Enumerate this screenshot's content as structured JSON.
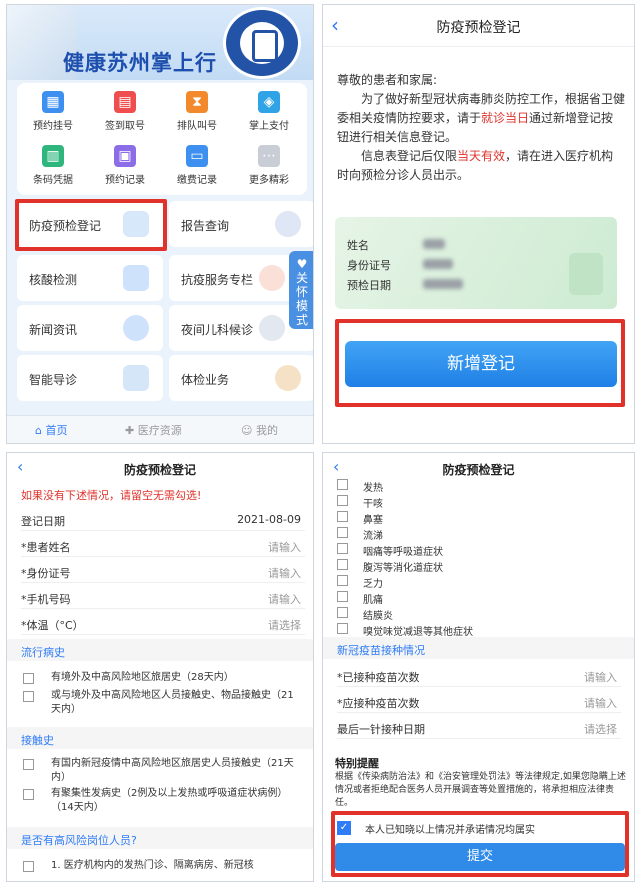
{
  "panel1": {
    "banner_title": "健康苏州掌上行",
    "grid": [
      {
        "label": "预约挂号",
        "icon": "calendar-icon"
      },
      {
        "label": "签到取号",
        "icon": "ticket-icon"
      },
      {
        "label": "排队叫号",
        "icon": "hourglass-icon"
      },
      {
        "label": "掌上支付",
        "icon": "payment-icon"
      },
      {
        "label": "条码凭据",
        "icon": "barcode-icon"
      },
      {
        "label": "预约记录",
        "icon": "record-icon"
      },
      {
        "label": "缴费记录",
        "icon": "wallet-icon"
      },
      {
        "label": "更多精彩",
        "icon": "more-icon"
      }
    ],
    "tiles": [
      {
        "label": "防疫预检登记"
      },
      {
        "label": "报告查询"
      },
      {
        "label": "核酸检测"
      },
      {
        "label": "抗疫服务专栏"
      },
      {
        "label": "新闻资讯"
      },
      {
        "label": "夜间儿科候诊"
      },
      {
        "label": "智能导诊"
      },
      {
        "label": "体检业务"
      }
    ],
    "care_mode": "关怀模式",
    "tabs": [
      {
        "label": "首页"
      },
      {
        "label": "医疗资源"
      },
      {
        "label": "我的"
      }
    ]
  },
  "panel2": {
    "title": "防疫预检登记",
    "greeting": "尊敬的患者和家属:",
    "para1_a": "为了做好新型冠状病毒肺炎防控工作，根据省卫健委相关疫情防控要求，请于",
    "para1_red": "就诊当日",
    "para1_b": "通过新增登记按钮进行相关信息登记。",
    "para2_a": "信息表登记后仅限",
    "para2_red": "当天有效",
    "para2_b": "，请在进入医疗机构时向预检分诊人员出示。",
    "card_labels": [
      "姓名",
      "身份证号",
      "预检日期"
    ],
    "add_button": "新增登记"
  },
  "panel3": {
    "title": "防疫预检登记",
    "warning": "如果没有下述情况，请留空无需勾选!",
    "fields": [
      {
        "label": "登记日期",
        "value": "2021-08-09"
      },
      {
        "label": "*患者姓名",
        "value": "请输入"
      },
      {
        "label": "*身份证号",
        "value": "请输入"
      },
      {
        "label": "*手机号码",
        "value": "请输入"
      },
      {
        "label": "*体温（°C）",
        "value": "请选择"
      }
    ],
    "sec_epi": "流行病史",
    "epi_options": [
      "有境外及中高风险地区旅居史（28天内）",
      "或与境外及中高风险地区人员接触史、物品接触史（21天内）"
    ],
    "sec_contact": "接触史",
    "contact_options": [
      "有国内新冠疫情中高风险地区旅居史人员接触史（21天内）",
      "有聚集性发病史（2例及以上发热或呼吸道症状病例）（14天内）"
    ],
    "sec_risk": "是否有高风险岗位人员?",
    "risk_option": "1. 医疗机构内的发热门诊、隔离病房、新冠核"
  },
  "panel4": {
    "title": "防疫预检登记",
    "symptoms": [
      "发热",
      "干咳",
      "鼻塞",
      "流涕",
      "咽痛等呼吸道症状",
      "腹泻等消化道症状",
      "乏力",
      "肌痛",
      "结膜炎",
      "嗅觉味觉减退等其他症状"
    ],
    "sec_vaccine": "新冠疫苗接种情况",
    "vaccine_fields": [
      {
        "label": "*已接种疫苗次数",
        "value": "请输入"
      },
      {
        "label": "*应接种疫苗次数",
        "value": "请输入"
      },
      {
        "label": "最后一针接种日期",
        "value": "请选择"
      }
    ],
    "tip_title": "特别提醒",
    "tip_text": "根据《传染病防治法》和《治安管理处罚法》等法律规定,如果您隐瞒上述情况或者拒绝配合医务人员开展调查等处置措施的，将承担相应法律责任。",
    "agree_text": "本人已知晓以上情况并承诺情况均属实",
    "submit": "提交"
  },
  "colors": {
    "accent": "#2f7cf6",
    "highlight_red": "#e0322b",
    "brand_blue": "#1e4fae"
  }
}
